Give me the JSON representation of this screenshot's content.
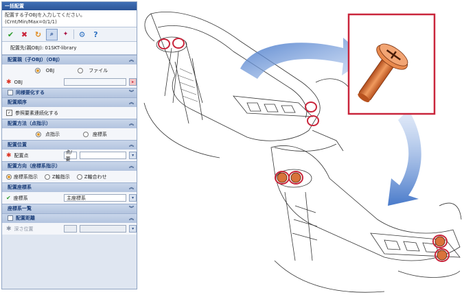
{
  "panel": {
    "title": "一括配置",
    "prompt_line1": "配置する子OBJを入力してください。",
    "prompt_line2": "(Crnt/Min/Max=0/1/1)",
    "destination": "配置先(親OBJ): 01SKT-library",
    "sections": {
      "child_obj": {
        "title": "配置親（子OBJ）（OBJ）",
        "radio_obj": "OBJ",
        "radio_file": "ファイル",
        "obj_label": "OBJ"
      },
      "collective": {
        "title": "同様要化する"
      },
      "order": {
        "title": "配置順序",
        "check_label": "参照要素連続化する"
      },
      "method": {
        "title": "配置方法（点指示）",
        "radio_point": "点指示",
        "radio_coord": "座標系"
      },
      "position": {
        "title": "配置位置",
        "point_label": "配置点",
        "btn": "点/要"
      },
      "direction": {
        "title": "配置方向（座標系指示）",
        "opt1": "座標系指示",
        "opt2": "Z軸指示",
        "opt3": "Z軸合わせ"
      },
      "coord": {
        "title": "配置座標系",
        "label": "座標系",
        "value": "主座標系"
      },
      "coord_list": {
        "title": "座標系一覧"
      },
      "distance": {
        "title": "配置距離",
        "label": "深さ位置"
      }
    }
  },
  "colors": {
    "accent": "#c9253b",
    "screw": "#d9733b",
    "arrow": "#3f73c7"
  },
  "icons": [
    "check-icon",
    "cancel-icon",
    "redo-icon",
    "search-icon",
    "pointer-icon",
    "gear-icon",
    "help-icon"
  ]
}
